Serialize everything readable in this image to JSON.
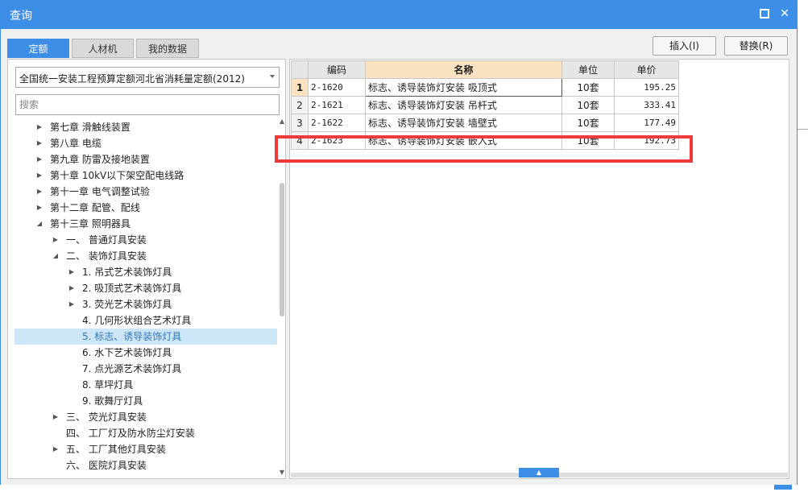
{
  "window": {
    "title": "查询"
  },
  "tabs": [
    {
      "label": "定额",
      "active": true
    },
    {
      "label": "人材机",
      "active": false
    },
    {
      "label": "我的数据",
      "active": false
    }
  ],
  "toolbar": {
    "insert_label": "插入(I)",
    "replace_label": "替换(R)"
  },
  "quota_select": {
    "value": "全国统一安装工程预算定额河北省消耗量定额(2012)"
  },
  "search": {
    "placeholder": "搜索"
  },
  "tree": [
    {
      "label": "第七章 滑触线装置",
      "level": 0,
      "expand": "collapsed"
    },
    {
      "label": "第八章 电缆",
      "level": 0,
      "expand": "collapsed"
    },
    {
      "label": "第九章 防雷及接地装置",
      "level": 0,
      "expand": "collapsed"
    },
    {
      "label": "第十章 10kV以下架空配电线路",
      "level": 0,
      "expand": "collapsed"
    },
    {
      "label": "第十一章 电气调整试验",
      "level": 0,
      "expand": "collapsed"
    },
    {
      "label": "第十二章 配管、配线",
      "level": 0,
      "expand": "collapsed"
    },
    {
      "label": "第十三章 照明器具",
      "level": 0,
      "expand": "expanded"
    },
    {
      "label": "一、  普通灯具安装",
      "level": 1,
      "expand": "collapsed"
    },
    {
      "label": "二、  装饰灯具安装",
      "level": 1,
      "expand": "expanded"
    },
    {
      "label": "1. 吊式艺术装饰灯具",
      "level": 2,
      "expand": "collapsed"
    },
    {
      "label": "2. 吸顶式艺术装饰灯具",
      "level": 2,
      "expand": "collapsed"
    },
    {
      "label": "3. 荧光艺术装饰灯具",
      "level": 2,
      "expand": "collapsed"
    },
    {
      "label": "4. 几何形状组合艺术灯具",
      "level": 2,
      "expand": "none"
    },
    {
      "label": "5. 标志、诱导装饰灯具",
      "level": 2,
      "expand": "none",
      "selected": true
    },
    {
      "label": "6. 水下艺术装饰灯具",
      "level": 2,
      "expand": "none"
    },
    {
      "label": "7. 点光源艺术装饰灯具",
      "level": 2,
      "expand": "none"
    },
    {
      "label": "8. 草坪灯具",
      "level": 2,
      "expand": "none"
    },
    {
      "label": "9. 歌舞厅灯具",
      "level": 2,
      "expand": "none"
    },
    {
      "label": "三、  荧光灯具安装",
      "level": 1,
      "expand": "collapsed"
    },
    {
      "label": "四、  工厂灯及防水防尘灯安装",
      "level": 1,
      "expand": "none"
    },
    {
      "label": "五、  工厂其他灯具安装",
      "level": 1,
      "expand": "collapsed"
    },
    {
      "label": "六、  医院灯具安装",
      "level": 1,
      "expand": "none"
    }
  ],
  "grid": {
    "columns": [
      "编码",
      "名称",
      "单位",
      "单价"
    ],
    "highlight_column": "名称",
    "rows": [
      {
        "index": "1",
        "code": "2-1620",
        "name": "标志、诱导装饰灯安装 吸顶式",
        "unit": "10套",
        "price": "195.25",
        "current": true
      },
      {
        "index": "2",
        "code": "2-1621",
        "name": "标志、诱导装饰灯安装 吊杆式",
        "unit": "10套",
        "price": "333.41"
      },
      {
        "index": "3",
        "code": "2-1622",
        "name": "标志、诱导装饰灯安装 墙壁式",
        "unit": "10套",
        "price": "177.49"
      },
      {
        "index": "4",
        "code": "2-1623",
        "name": "标志、诱导装饰灯安装 嵌入式",
        "unit": "10套",
        "price": "192.73"
      }
    ]
  },
  "colors": {
    "accent": "#3d8ee6",
    "highlight_border": "#ee3a3a",
    "header_highlight": "#fbe3c2",
    "tree_selected": "#cde6f7"
  }
}
